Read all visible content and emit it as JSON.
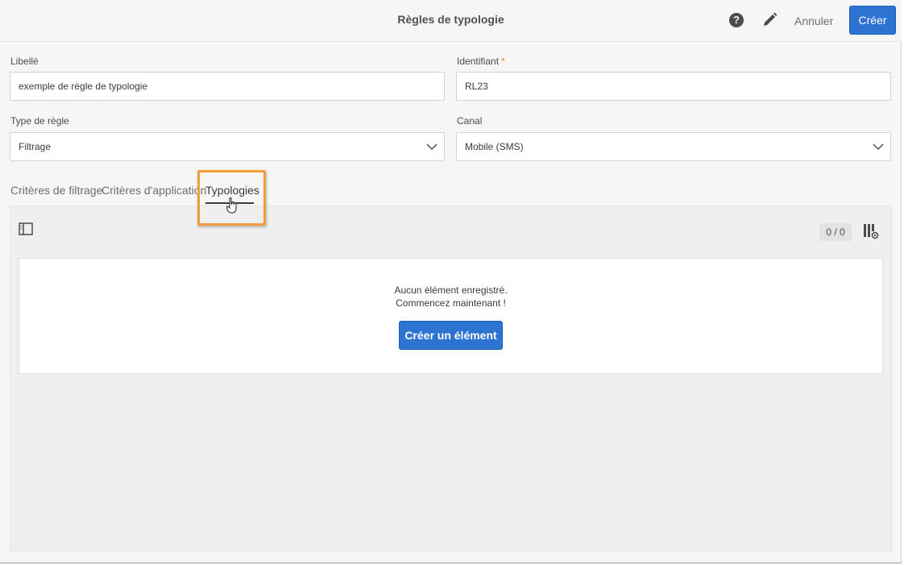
{
  "header": {
    "title": "Règles de typologie",
    "cancel_label": "Annuler",
    "create_label": "Créer"
  },
  "form": {
    "libelle": {
      "label": "Libellé",
      "value": "exemple de règle de typologie"
    },
    "identifiant": {
      "label": "Identifiant",
      "required_mark": "*",
      "value": "RL23"
    },
    "type_regle": {
      "label": "Type de règle",
      "value": "Filtrage"
    },
    "canal": {
      "label": "Canal",
      "value": "Mobile (SMS)"
    }
  },
  "tabs": [
    {
      "label": "Critères de filtrage"
    },
    {
      "label": "Critères d'application"
    },
    {
      "label": "Typologies",
      "active": true
    }
  ],
  "panel": {
    "counter": "0 / 0",
    "empty_line1": "Aucun élément enregistré.",
    "empty_line2": "Commencez maintenant !",
    "create_element_label": "Créer un élément"
  },
  "icons": {
    "help": "question-circle",
    "edit": "pencil",
    "chevron": "chevron-down",
    "panel_toggle": "sidebar-toggle",
    "column_settings": "columns-gear",
    "cursor": "hand-pointer"
  },
  "colors": {
    "accent": "#2d73d2",
    "highlight": "#f29b38",
    "required": "#e68619"
  }
}
